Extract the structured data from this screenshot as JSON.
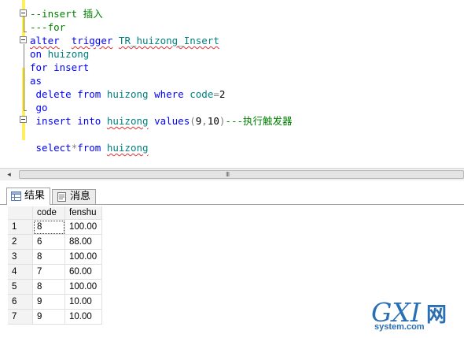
{
  "editor": {
    "lines": [
      {
        "id": "l1",
        "tokens": [
          {
            "t": "cm",
            "v": "--insert 插入"
          }
        ]
      },
      {
        "id": "l2",
        "tokens": [
          {
            "t": "cm",
            "v": "---for"
          }
        ]
      },
      {
        "id": "l3",
        "tokens": [
          {
            "t": "kw",
            "v": "alter",
            "sq": true
          },
          {
            "t": "tx",
            "v": "  "
          },
          {
            "t": "kw",
            "v": "trigger",
            "sq": true
          },
          {
            "t": "tx",
            "v": " "
          },
          {
            "t": "id",
            "v": "TR_huizong_Insert",
            "sq": true
          }
        ]
      },
      {
        "id": "l4",
        "tokens": [
          {
            "t": "kw",
            "v": "on"
          },
          {
            "t": "tx",
            "v": " "
          },
          {
            "t": "id",
            "v": "huizong"
          }
        ]
      },
      {
        "id": "l5",
        "tokens": [
          {
            "t": "kw",
            "v": "for"
          },
          {
            "t": "tx",
            "v": " "
          },
          {
            "t": "kw",
            "v": "insert"
          }
        ]
      },
      {
        "id": "l6",
        "tokens": [
          {
            "t": "kw",
            "v": "as"
          }
        ]
      },
      {
        "id": "l7",
        "tokens": [
          {
            "t": "tx",
            "v": " "
          },
          {
            "t": "kw",
            "v": "delete"
          },
          {
            "t": "tx",
            "v": " "
          },
          {
            "t": "kw",
            "v": "from"
          },
          {
            "t": "tx",
            "v": " "
          },
          {
            "t": "id",
            "v": "huizong"
          },
          {
            "t": "tx",
            "v": " "
          },
          {
            "t": "kw",
            "v": "where"
          },
          {
            "t": "tx",
            "v": " "
          },
          {
            "t": "id",
            "v": "code"
          },
          {
            "t": "op",
            "v": "="
          },
          {
            "t": "nm",
            "v": "2"
          }
        ]
      },
      {
        "id": "l8",
        "tokens": [
          {
            "t": "tx",
            "v": " "
          },
          {
            "t": "kw",
            "v": "go"
          }
        ]
      },
      {
        "id": "l9",
        "tokens": [
          {
            "t": "tx",
            "v": " "
          },
          {
            "t": "kw",
            "v": "insert"
          },
          {
            "t": "tx",
            "v": " "
          },
          {
            "t": "kw",
            "v": "into"
          },
          {
            "t": "tx",
            "v": " "
          },
          {
            "t": "id",
            "v": "huizong",
            "sq": true
          },
          {
            "t": "tx",
            "v": " "
          },
          {
            "t": "kw",
            "v": "values"
          },
          {
            "t": "op",
            "v": "("
          },
          {
            "t": "nm",
            "v": "9"
          },
          {
            "t": "op",
            "v": ","
          },
          {
            "t": "nm",
            "v": "10"
          },
          {
            "t": "op",
            "v": ")"
          },
          {
            "t": "cm",
            "v": "---执行触发器"
          }
        ]
      },
      {
        "id": "l10",
        "tokens": []
      },
      {
        "id": "l11",
        "tokens": [
          {
            "t": "tx",
            "v": " "
          },
          {
            "t": "kw",
            "v": "select"
          },
          {
            "t": "op",
            "v": "*"
          },
          {
            "t": "kw",
            "v": "from"
          },
          {
            "t": "tx",
            "v": " "
          },
          {
            "t": "id",
            "v": "huizong",
            "sq": true
          }
        ]
      }
    ]
  },
  "scrollbar": {
    "left_arrow": "◂",
    "right_arrow": "▸",
    "grip": "III"
  },
  "tabs": [
    {
      "label": "结果",
      "active": true,
      "icon": "grid-icon"
    },
    {
      "label": "消息",
      "active": false,
      "icon": "message-icon"
    }
  ],
  "results": {
    "columns": [
      "code",
      "fenshu"
    ],
    "rows": [
      {
        "n": "1",
        "code": "8",
        "fenshu": "100.00"
      },
      {
        "n": "2",
        "code": "6",
        "fenshu": "88.00"
      },
      {
        "n": "3",
        "code": "8",
        "fenshu": "100.00"
      },
      {
        "n": "4",
        "code": "7",
        "fenshu": "60.00"
      },
      {
        "n": "5",
        "code": "8",
        "fenshu": "100.00"
      },
      {
        "n": "6",
        "code": "9",
        "fenshu": "10.00"
      },
      {
        "n": "7",
        "code": "9",
        "fenshu": "10.00"
      }
    ]
  },
  "watermark": {
    "letters": "GXI",
    "cn": "网",
    "url": "system.com"
  },
  "colors": {
    "keyword": "#0000ff",
    "comment": "#008000",
    "identifier": "#008080",
    "operator": "#808080",
    "changebar": "#ffef5c",
    "watermark": "#2a6fb3"
  }
}
